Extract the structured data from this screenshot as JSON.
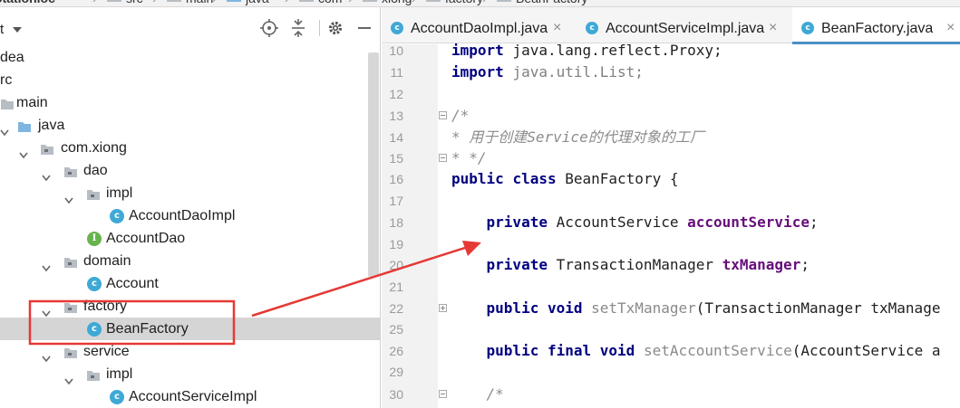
{
  "breadcrumb": [
    "otationioc",
    "src",
    "main",
    "java",
    "com",
    "xiong",
    "factory",
    "BeanFactory"
  ],
  "project": {
    "title_fragment": "t",
    "toolbar": {
      "locate_icon": "crosshair-icon",
      "collapse_icon": "collapse-all-icon",
      "settings_icon": "gear-icon",
      "hide_icon": "minimize-icon"
    },
    "tree": [
      {
        "label": "dea",
        "icon": "none"
      },
      {
        "label": "rc",
        "icon": "none"
      },
      {
        "label": "main",
        "icon": "folder"
      },
      {
        "label": "java",
        "icon": "source-folder"
      },
      {
        "label": "com.xiong",
        "icon": "package"
      },
      {
        "label": "dao",
        "icon": "package"
      },
      {
        "label": "impl",
        "icon": "package"
      },
      {
        "label": "AccountDaoImpl",
        "icon": "class"
      },
      {
        "label": "AccountDao",
        "icon": "interface"
      },
      {
        "label": "domain",
        "icon": "package"
      },
      {
        "label": "Account",
        "icon": "class"
      },
      {
        "label": "factory",
        "icon": "package"
      },
      {
        "label": "BeanFactory",
        "icon": "class",
        "selected": true
      },
      {
        "label": "service",
        "icon": "package"
      },
      {
        "label": "impl",
        "icon": "package"
      },
      {
        "label": "AccountServiceImpl",
        "icon": "class"
      }
    ],
    "class_badge": "c",
    "interface_badge": "I"
  },
  "tabs": [
    {
      "label": "AccountDaoImpl.java",
      "close": "×"
    },
    {
      "label": "AccountServiceImpl.java",
      "close": "×"
    },
    {
      "label": "BeanFactory.java",
      "close": "×",
      "active": true
    }
  ],
  "code_lines": [
    {
      "n": "10",
      "text": "import java.lang.reflect.Proxy;"
    },
    {
      "n": "11",
      "text": "import java.util.List;"
    },
    {
      "n": "12",
      "text": ""
    },
    {
      "n": "13",
      "text": "/*"
    },
    {
      "n": "14",
      "text": "* 用于创建Service的代理对象的工厂"
    },
    {
      "n": "15",
      "text": "* */"
    },
    {
      "n": "16",
      "text": "public class BeanFactory {"
    },
    {
      "n": "17",
      "text": ""
    },
    {
      "n": "18",
      "text": "    private AccountService accountService;"
    },
    {
      "n": "19",
      "text": ""
    },
    {
      "n": "20",
      "text": "    private TransactionManager txManager;"
    },
    {
      "n": "21",
      "text": ""
    },
    {
      "n": "22",
      "text": "    public void setTxManager(TransactionManager txManage"
    },
    {
      "n": "25",
      "text": ""
    },
    {
      "n": "26",
      "text": "    public final void setAccountService(AccountService a"
    },
    {
      "n": "29",
      "text": ""
    },
    {
      "n": "30",
      "text": "    /*"
    }
  ],
  "annotation": {
    "highlight_color": "#e53935",
    "arrow_color": "#e53935"
  }
}
